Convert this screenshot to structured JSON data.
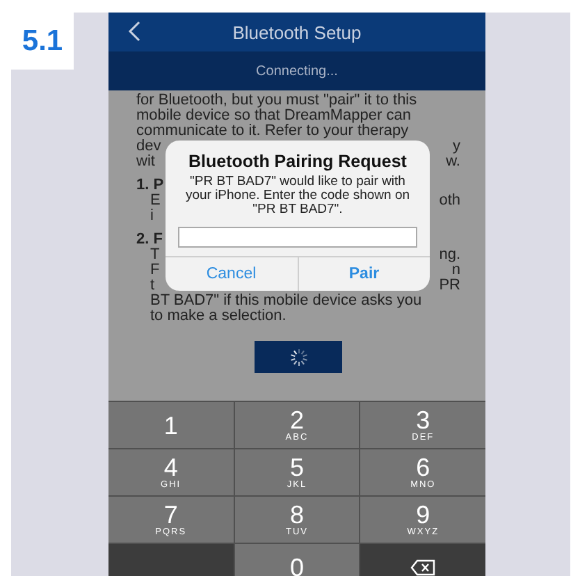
{
  "figure_label": "5.1",
  "header": {
    "title": "Bluetooth Setup",
    "status": "Connecting..."
  },
  "background_text": [
    {
      "kind": "para",
      "left": "for Bluetooth, but you must \"pair\" it to this"
    },
    {
      "kind": "para",
      "left": "mobile device so that DreamMapper can"
    },
    {
      "kind": "para",
      "left": "communicate to it. Refer to your therapy"
    },
    {
      "kind": "para",
      "left": "dev",
      "right": "y"
    },
    {
      "kind": "para",
      "left": "wit",
      "right": "w."
    },
    {
      "kind": "heading",
      "left": "1. P"
    },
    {
      "kind": "item",
      "left": "E",
      "right": "oth"
    },
    {
      "kind": "item",
      "left": "i"
    },
    {
      "kind": "heading",
      "left": "2. F"
    },
    {
      "kind": "item",
      "left": "T",
      "right": "ng."
    },
    {
      "kind": "item",
      "left": "F",
      "right": "n"
    },
    {
      "kind": "item",
      "left": "t",
      "right": "PR"
    },
    {
      "kind": "item",
      "left": "BT BAD7\" if this mobile device asks you"
    },
    {
      "kind": "item",
      "left": "to make a selection."
    }
  ],
  "dialog": {
    "title": "Bluetooth Pairing Request",
    "message": "\"PR BT BAD7\" would like to pair with your iPhone. Enter the code shown on \"PR BT BAD7\".",
    "buttons": [
      {
        "label": "Cancel",
        "kind": "cancel"
      },
      {
        "label": "Pair",
        "kind": "default"
      }
    ]
  },
  "keypad": [
    {
      "kind": "digit",
      "digit": "1"
    },
    {
      "kind": "digit",
      "digit": "2",
      "letters": "ABC"
    },
    {
      "kind": "digit",
      "digit": "3",
      "letters": "DEF"
    },
    {
      "kind": "digit",
      "digit": "4",
      "letters": "GHI"
    },
    {
      "kind": "digit",
      "digit": "5",
      "letters": "JKL"
    },
    {
      "kind": "digit",
      "digit": "6",
      "letters": "MNO"
    },
    {
      "kind": "digit",
      "digit": "7",
      "letters": "PQRS"
    },
    {
      "kind": "digit",
      "digit": "8",
      "letters": "TUV"
    },
    {
      "kind": "digit",
      "digit": "9",
      "letters": "WXYZ"
    },
    {
      "kind": "blank"
    },
    {
      "kind": "digit",
      "digit": "0"
    },
    {
      "kind": "delete"
    }
  ]
}
